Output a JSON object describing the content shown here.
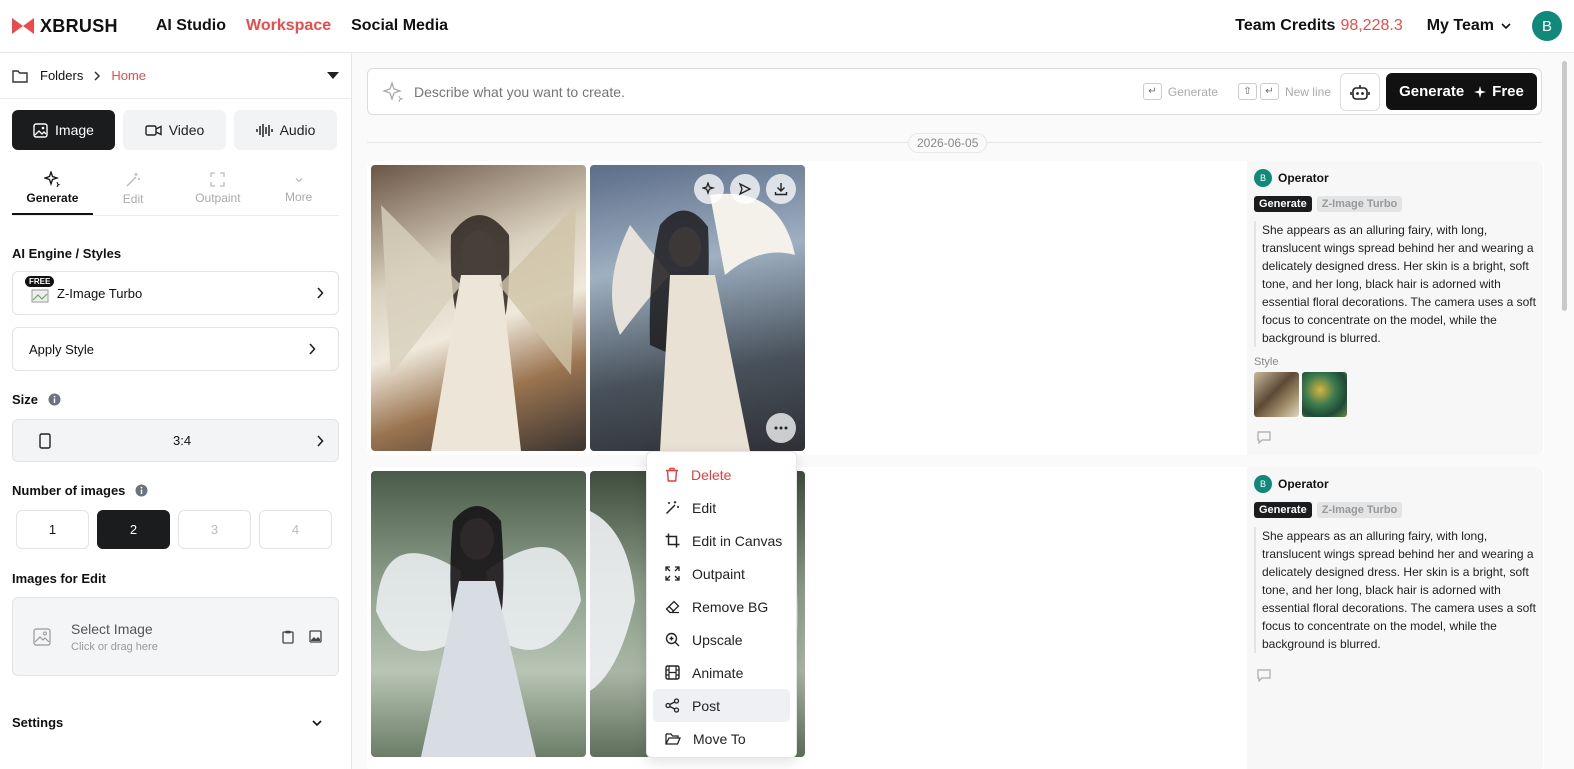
{
  "brand": "XBRUSH",
  "nav": [
    "AI Studio",
    "Workspace",
    "Social Media"
  ],
  "credits": {
    "label": "Team Credits",
    "value": "98,228.3"
  },
  "team": "My Team",
  "user_initial": "B",
  "breadcrumb": {
    "root": "Folders",
    "current": "Home"
  },
  "media_tabs": [
    "Image",
    "Video",
    "Audio"
  ],
  "tool_tabs": [
    "Generate",
    "Edit",
    "Outpaint",
    "More"
  ],
  "engine": {
    "label": "AI Engine / Styles",
    "badge": "FREE",
    "name": "Z-Image Turbo",
    "apply": "Apply Style"
  },
  "size": {
    "label": "Size",
    "value": "3:4"
  },
  "num_images": {
    "label": "Number of images",
    "options": [
      "1",
      "2",
      "3",
      "4"
    ]
  },
  "edit_images": {
    "label": "Images for Edit",
    "title": "Select Image",
    "sub": "Click or drag here"
  },
  "settings": "Settings",
  "prompt": {
    "placeholder": "Describe what you want to create.",
    "hint1": "Generate",
    "hint2": "New line",
    "button": "Generate",
    "button_extra": "Free"
  },
  "date": "2026-06-05",
  "cards": [
    {
      "user": "Operator",
      "tag1": "Generate",
      "tag2": "Z-Image Turbo",
      "desc": "She appears as an alluring fairy, with long, translucent wings spread behind her and wearing a delicately designed dress. Her skin is a bright, soft tone, and her long, black hair is adorned with essential floral decorations. The camera uses a soft focus to concentrate on the model, while the background is blurred.",
      "style_label": "Style"
    },
    {
      "user": "Operator",
      "tag1": "Generate",
      "tag2": "Z-Image Turbo",
      "desc": "She appears as an alluring fairy, with long, translucent wings spread behind her and wearing a delicately designed dress. Her skin is a bright, soft tone, and her long, black hair is adorned with essential floral decorations. The camera uses a soft focus to concentrate on the model, while the background is blurred."
    }
  ],
  "context_menu": [
    "Delete",
    "Edit",
    "Edit in Canvas",
    "Outpaint",
    "Remove BG",
    "Upscale",
    "Animate",
    "Post",
    "Move To"
  ],
  "colors": {
    "accent": "#ea4b4b",
    "dark": "#1b1c1e",
    "avatar": "#10897a"
  }
}
